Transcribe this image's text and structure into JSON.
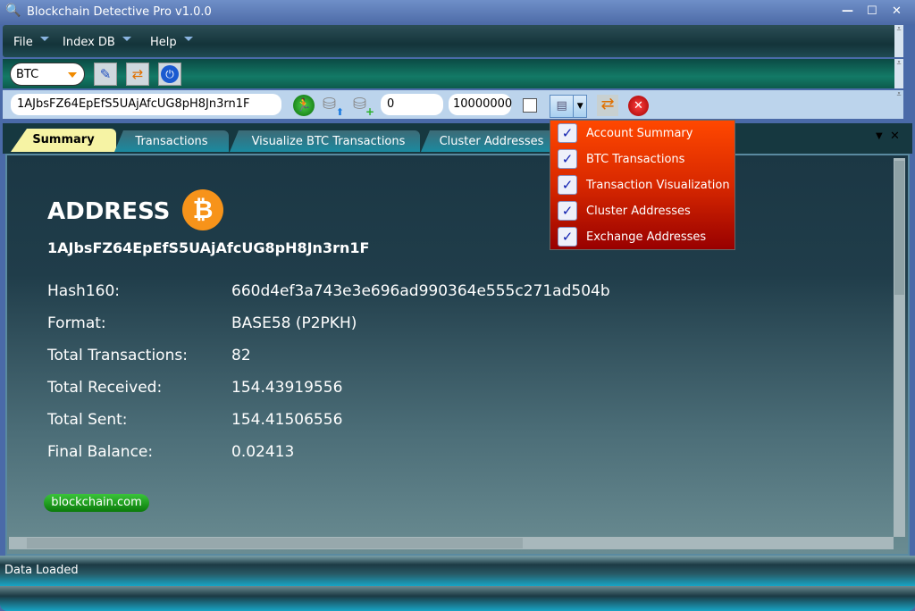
{
  "window": {
    "title": "Blockchain Detective Pro v1.0.0",
    "controls": [
      "minimize",
      "maximize",
      "close"
    ]
  },
  "menu": [
    "File",
    "Index DB",
    "Help"
  ],
  "toolbar1": {
    "currency": "BTC"
  },
  "toolbar2": {
    "address": "1AJbsFZ64EpEfS5UAjAfcUG8pH8Jn3rn1F",
    "from": "0",
    "to": "10000000",
    "checkbox_checked": false
  },
  "tabs": [
    "Summary",
    "Transactions",
    "Visualize BTC Transactions",
    "Cluster Addresses"
  ],
  "dropdown": {
    "items": [
      {
        "label": "Account Summary",
        "checked": true
      },
      {
        "label": "BTC Transactions",
        "checked": true
      },
      {
        "label": "Transaction Visualization",
        "checked": true
      },
      {
        "label": "Cluster Addresses",
        "checked": true
      },
      {
        "label": "Exchange Addresses",
        "checked": true
      }
    ]
  },
  "summary": {
    "heading": "ADDRESS",
    "address": "1AJbsFZ64EpEfS5UAjAfcUG8pH8Jn3rn1F",
    "rows": [
      {
        "label": "Hash160:",
        "value": "660d4ef3a743e3e696ad990364e555c271ad504b"
      },
      {
        "label": "Format:",
        "value": "BASE58 (P2PKH)"
      },
      {
        "label": "Total Transactions:",
        "value": "82"
      },
      {
        "label": "Total Received:",
        "value": "154.43919556"
      },
      {
        "label": "Total Sent:",
        "value": "154.41506556"
      },
      {
        "label": "Final Balance:",
        "value": "0.02413"
      }
    ],
    "link": "blockchain.com"
  },
  "status": "Data Loaded",
  "colors": {
    "accent_tab": "#f6f3a4",
    "dropdown_top": "#ff4800",
    "dropdown_bottom": "#980000",
    "bitcoin": "#f7931a",
    "link_button": "#1a9a1a"
  }
}
